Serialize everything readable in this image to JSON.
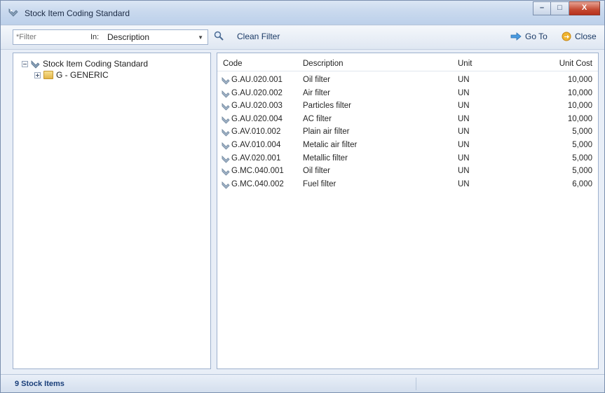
{
  "window": {
    "title": "Stock Item Coding Standard",
    "controls": {
      "minimize": "–",
      "maximize": "□",
      "close": "X"
    }
  },
  "toolbar": {
    "filter_placeholder": "*Filter",
    "in_label": "In:",
    "search_field": "Description",
    "clean_filter_label": "Clean Filter",
    "go_to_label": "Go To",
    "close_label": "Close"
  },
  "tree": {
    "root_label": "Stock Item Coding Standard",
    "children": [
      {
        "label": "G - GENERIC"
      }
    ]
  },
  "list": {
    "columns": [
      "Code",
      "Description",
      "Unit",
      "Unit Cost"
    ],
    "rows": [
      {
        "code": "G.AU.020.001",
        "description": "Oil filter",
        "unit": "UN",
        "unit_cost": "10,000"
      },
      {
        "code": "G.AU.020.002",
        "description": "Air filter",
        "unit": "UN",
        "unit_cost": "10,000"
      },
      {
        "code": "G.AU.020.003",
        "description": "Particles filter",
        "unit": "UN",
        "unit_cost": "10,000"
      },
      {
        "code": "G.AU.020.004",
        "description": "AC filter",
        "unit": "UN",
        "unit_cost": "10,000"
      },
      {
        "code": "G.AV.010.002",
        "description": "Plain air filter",
        "unit": "UN",
        "unit_cost": "5,000"
      },
      {
        "code": "G.AV.010.004",
        "description": "Metalic air filter",
        "unit": "UN",
        "unit_cost": "5,000"
      },
      {
        "code": "G.AV.020.001",
        "description": "Metallic filter",
        "unit": "UN",
        "unit_cost": "5,000"
      },
      {
        "code": "G.MC.040.001",
        "description": "Oil filter",
        "unit": "UN",
        "unit_cost": "5,000"
      },
      {
        "code": "G.MC.040.002",
        "description": "Fuel filter",
        "unit": "UN",
        "unit_cost": "6,000"
      }
    ]
  },
  "status": {
    "text": "9 Stock Items"
  },
  "colors": {
    "accent": "#1b3a66",
    "status_text": "#1a3f7a",
    "close_button": "#c44a32"
  },
  "icons": [
    "app-icon",
    "search-icon",
    "go-to-arrow-icon",
    "close-circle-icon",
    "folder-icon",
    "stock-item-icon"
  ]
}
